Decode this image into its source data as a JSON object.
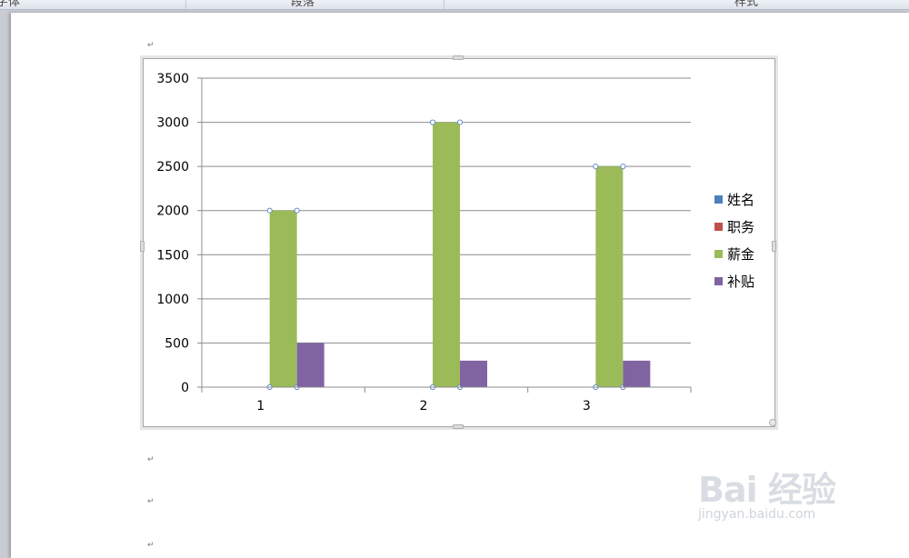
{
  "ribbon": {
    "groups": [
      "字体",
      "段落",
      "样式"
    ]
  },
  "document": {
    "paragraph_mark": "↵"
  },
  "chart_data": {
    "type": "bar",
    "categories": [
      "1",
      "2",
      "3"
    ],
    "series": [
      {
        "name": "姓名",
        "values": [
          0,
          0,
          0
        ],
        "color": "#4f81bd"
      },
      {
        "name": "职务",
        "values": [
          0,
          0,
          0
        ],
        "color": "#c0504d"
      },
      {
        "name": "薪金",
        "values": [
          2000,
          3000,
          2500
        ],
        "color": "#9bbb59"
      },
      {
        "name": "补贴",
        "values": [
          500,
          300,
          300
        ],
        "color": "#8064a2"
      }
    ],
    "ylim": [
      0,
      3500
    ],
    "yticks": [
      "0",
      "500",
      "1000",
      "1500",
      "2000",
      "2500",
      "3000",
      "3500"
    ],
    "title": "",
    "xlabel": "",
    "ylabel": "",
    "grid": true,
    "legend": "right"
  },
  "watermark": {
    "brand": "Bai 经验",
    "url": "jingyan.baidu.com"
  }
}
